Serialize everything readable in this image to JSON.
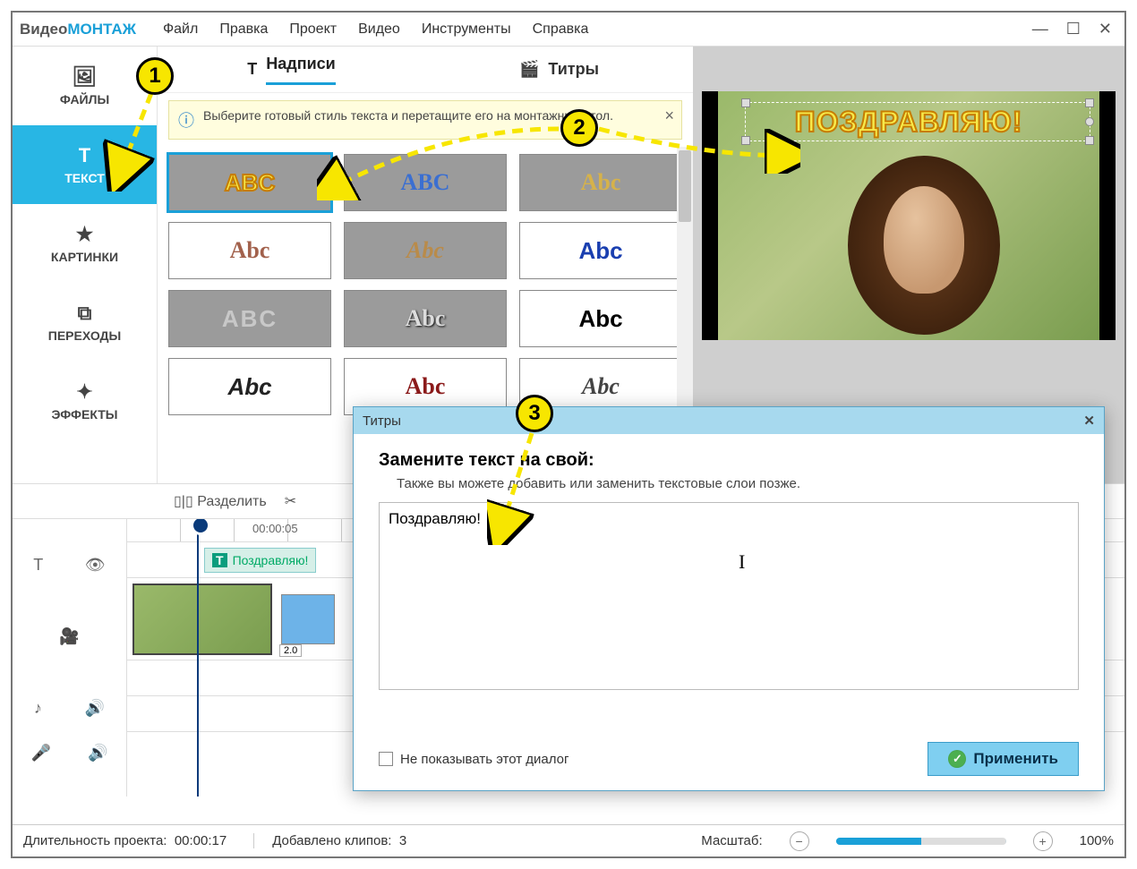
{
  "app": {
    "logo_a": "Видео",
    "logo_b": "МОНТАЖ"
  },
  "menu": {
    "file": "Файл",
    "edit": "Правка",
    "project": "Проект",
    "video": "Видео",
    "tools": "Инструменты",
    "help": "Справка"
  },
  "sidebar": {
    "files": "ФАЙЛЫ",
    "text": "ТЕКСТ",
    "images": "КАРТИНКИ",
    "transitions": "ПЕРЕХОДЫ",
    "effects": "ЭФФЕКТЫ"
  },
  "tabs": {
    "labels": "Надписи",
    "titles": "Титры"
  },
  "tip": "Выберите готовый стиль текста и перетащите его на монтажный стол.",
  "styles": [
    {
      "txt": "ABC",
      "css": "color:#f7e94a;-webkit-text-stroke:2px #c77d00;font-weight:900;",
      "sel": true
    },
    {
      "txt": "ABC",
      "css": "color:#3b6fd1;font-family:cursive;font-weight:bold;"
    },
    {
      "txt": "Abc",
      "css": "color:#d6b24a;font-family:Georgia;font-weight:bold;"
    },
    {
      "txt": "Abc",
      "css": "color:#a2614c;font-family:Georgia;",
      "white": true
    },
    {
      "txt": "Abc",
      "css": "color:#b98b4a;font-family:Georgia;font-style:italic;"
    },
    {
      "txt": "Abc",
      "css": "color:#1a3fb0;font-weight:bold;",
      "white": true
    },
    {
      "txt": "ABC",
      "css": "color:#c8c8c8;font-family:Arial;letter-spacing:2px;"
    },
    {
      "txt": "Abc",
      "css": "color:#ddd;font-family:Georgia;text-shadow:1px 1px 2px #000;"
    },
    {
      "txt": "Abc",
      "css": "color:#000;font-weight:bold;",
      "white": true
    },
    {
      "txt": "Abc",
      "css": "color:#222;font-style:italic;font-weight:bold;",
      "white": true
    },
    {
      "txt": "Abc",
      "css": "color:#8b1a1a;font-family:'Old English Text MT',serif;",
      "white": true
    },
    {
      "txt": "Abc",
      "css": "color:#444;font-family:cursive;font-style:italic;",
      "white": true
    }
  ],
  "preview": {
    "overlay_text": "ПОЗДРАВЛЯЮ!"
  },
  "toolbar": {
    "split": "Разделить"
  },
  "timeline": {
    "time_label": "00:00:05",
    "text_clip": "Поздравляю!",
    "transition_dur": "2.0"
  },
  "status": {
    "duration_label": "Длительность проекта:",
    "duration": "00:00:17",
    "clips_label": "Добавлено клипов:",
    "clips": "3",
    "zoom_label": "Масштаб:",
    "zoom_pct": "100%"
  },
  "dialog": {
    "title": "Титры",
    "heading": "Замените текст на свой:",
    "sub": "Также вы можете добавить или заменить текстовые слои позже.",
    "value": "Поздравляю!",
    "dont_show": "Не показывать этот диалог",
    "apply": "Применить"
  },
  "bubbles": {
    "b1": "1",
    "b2": "2",
    "b3": "3"
  }
}
